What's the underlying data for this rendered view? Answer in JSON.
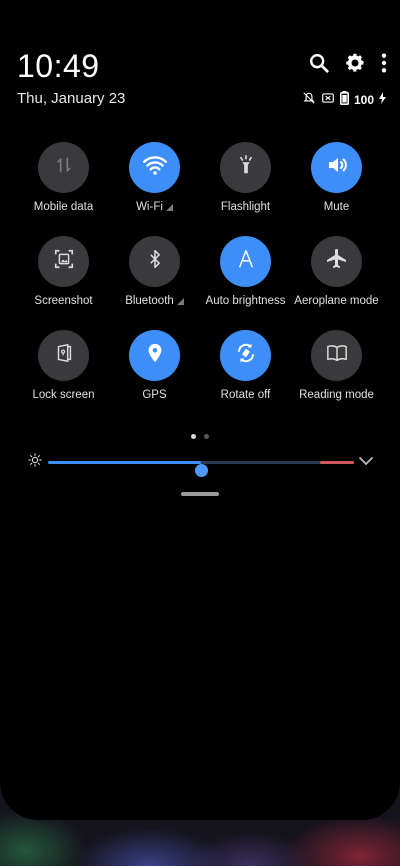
{
  "clock": {
    "time": "10:49",
    "date": "Thu, January 23"
  },
  "status": {
    "battery": "100"
  },
  "header_icons": [
    "search-icon",
    "gear-icon",
    "more-vert-icon"
  ],
  "colors": {
    "accent": "#3e8ef7",
    "tile_off": "#3a3a3c",
    "background": "#000000"
  },
  "tiles": [
    {
      "label": "Mobile data",
      "icon": "mobile-data-icon",
      "on": false
    },
    {
      "label": "Wi-Fi",
      "icon": "wifi-icon",
      "on": true
    },
    {
      "label": "Flashlight",
      "icon": "flashlight-icon",
      "on": false
    },
    {
      "label": "Mute",
      "icon": "volume-icon",
      "on": true
    },
    {
      "label": "Screenshot",
      "icon": "screenshot-icon",
      "on": false
    },
    {
      "label": "Bluetooth",
      "icon": "bluetooth-icon",
      "on": false
    },
    {
      "label": "Auto brightness",
      "icon": "auto-brightness-icon",
      "on": true
    },
    {
      "label": "Aeroplane mode",
      "icon": "airplane-icon",
      "on": false
    },
    {
      "label": "Lock screen",
      "icon": "lock-screen-icon",
      "on": false
    },
    {
      "label": "GPS",
      "icon": "location-pin-icon",
      "on": true
    },
    {
      "label": "Rotate off",
      "icon": "rotate-icon",
      "on": true
    },
    {
      "label": "Reading mode",
      "icon": "book-icon",
      "on": false
    }
  ],
  "pager": {
    "pages": 2,
    "current": 1
  },
  "brightness": {
    "level": 0.5
  }
}
